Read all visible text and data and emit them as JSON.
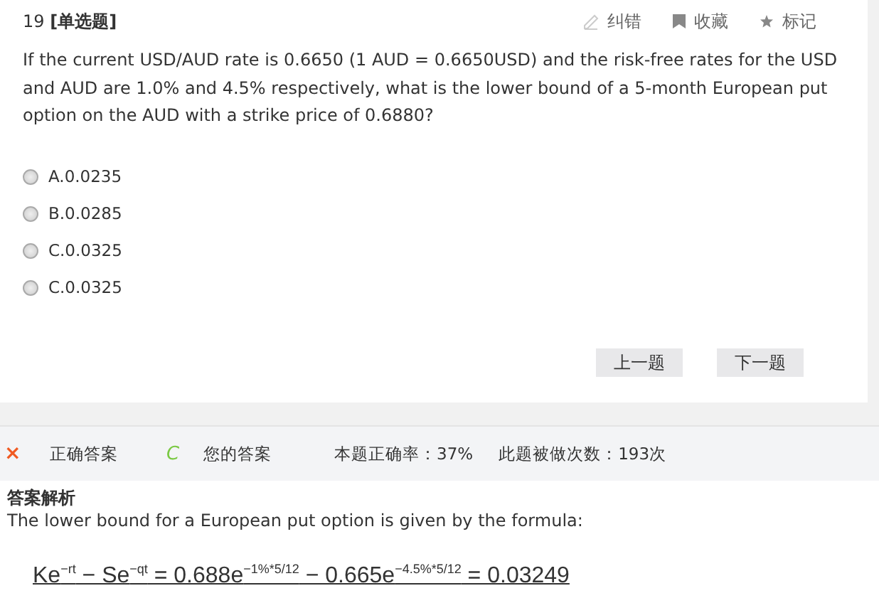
{
  "question": {
    "number": "19",
    "type": "[单选题]",
    "actions": [
      {
        "kind": "pen",
        "label": "纠错"
      },
      {
        "kind": "bookmark",
        "label": "收藏"
      },
      {
        "kind": "star",
        "label": "标记"
      }
    ],
    "text": "If the current USD/AUD rate is 0.6650 (1 AUD = 0.6650USD) and the risk-free rates for the USD and AUD are 1.0% and 4.5% respectively, what is the lower bound of a 5-month European put option on the AUD with a strike price of 0.6880?",
    "options": [
      {
        "label": "A.0.0235",
        "selected": false
      },
      {
        "label": "B.0.0285",
        "selected": false
      },
      {
        "label": "C.0.0325",
        "selected": false
      },
      {
        "label": "C.0.0325",
        "selected": false
      }
    ],
    "buttons": [
      "上一题",
      "下一题"
    ]
  },
  "result": {
    "correct_mark": "×",
    "correct_label": "正确答案",
    "your_mark": "C",
    "your_label": "您的答案",
    "accuracy": "本题正确率：37%",
    "attempts": "此题被做次数：193次"
  },
  "explanation": {
    "title": "答案解析",
    "text": "The lower bound for a European put option is given by the formula:",
    "formula": "Ke$^{−rt}$ − Se$^{−qt}$ = 0.688e$^{−1%*5/12}$ − 0.665e$^{−4.5%*5/12}$ = 0.03249"
  }
}
